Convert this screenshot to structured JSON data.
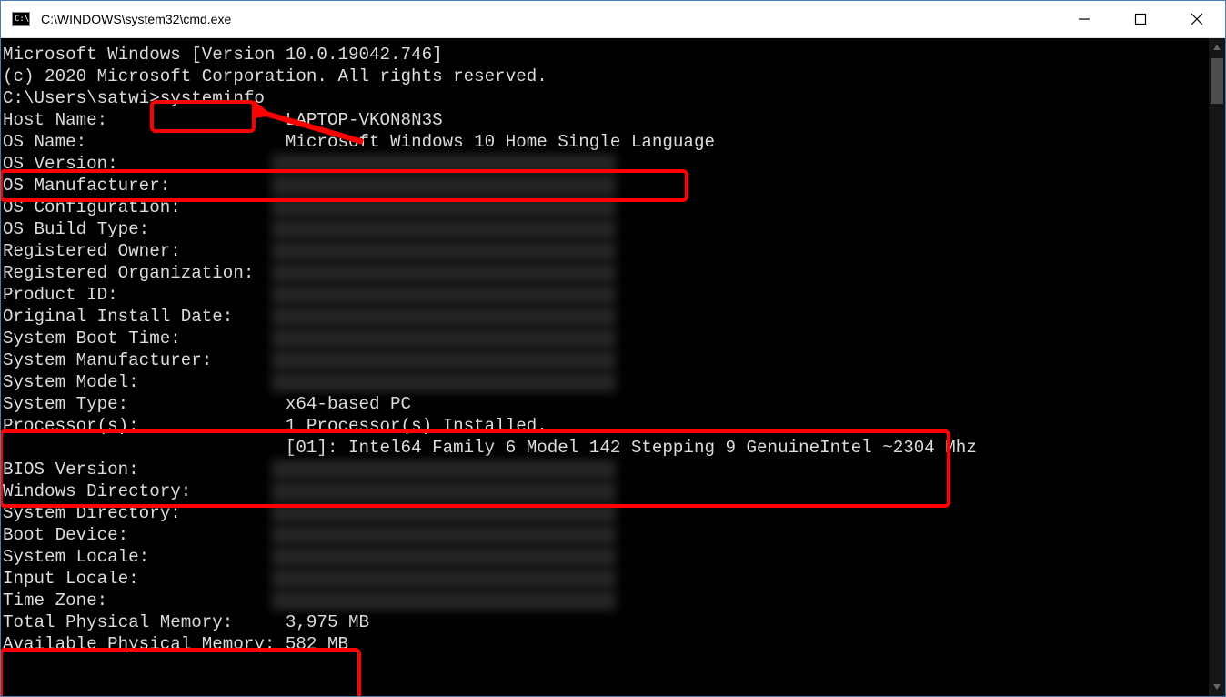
{
  "window": {
    "title": "C:\\WINDOWS\\system32\\cmd.exe",
    "icon_label": "C:\\."
  },
  "header": {
    "line1": "Microsoft Windows [Version 10.0.19042.746]",
    "line2": "(c) 2020 Microsoft Corporation. All rights reserved."
  },
  "prompt": {
    "path": "C:\\Users\\satwi>",
    "command": "systeminfo"
  },
  "rows": [
    {
      "label": "Host Name:",
      "value": "LAPTOP-VKON8N3S",
      "redacted": false
    },
    {
      "label": "OS Name:",
      "value": "Microsoft Windows 10 Home Single Language",
      "redacted": false
    },
    {
      "label": "OS Version:",
      "value": "",
      "redacted": true
    },
    {
      "label": "OS Manufacturer:",
      "value": "",
      "redacted": true
    },
    {
      "label": "OS Configuration:",
      "value": "",
      "redacted": true
    },
    {
      "label": "OS Build Type:",
      "value": "",
      "redacted": true
    },
    {
      "label": "Registered Owner:",
      "value": "",
      "redacted": true
    },
    {
      "label": "Registered Organization:",
      "value": "",
      "redacted": true
    },
    {
      "label": "Product ID:",
      "value": "",
      "redacted": true
    },
    {
      "label": "Original Install Date:",
      "value": "",
      "redacted": true
    },
    {
      "label": "System Boot Time:",
      "value": "",
      "redacted": true
    },
    {
      "label": "System Manufacturer:",
      "value": "",
      "redacted": true
    },
    {
      "label": "System Model:",
      "value": "",
      "redacted": true
    },
    {
      "label": "System Type:",
      "value": "x64-based PC",
      "redacted": false
    },
    {
      "label": "Processor(s):",
      "value": "1 Processor(s) Installed.",
      "redacted": false
    },
    {
      "label": "",
      "value": "[01]: Intel64 Family 6 Model 142 Stepping 9 GenuineIntel ~2304 Mhz",
      "redacted": false
    },
    {
      "label": "BIOS Version:",
      "value": "",
      "redacted": true
    },
    {
      "label": "Windows Directory:",
      "value": "",
      "redacted": true
    },
    {
      "label": "System Directory:",
      "value": "",
      "redacted": true
    },
    {
      "label": "Boot Device:",
      "value": "",
      "redacted": true
    },
    {
      "label": "System Locale:",
      "value": "",
      "redacted": true
    },
    {
      "label": "Input Locale:",
      "value": "",
      "redacted": true
    },
    {
      "label": "Time Zone:",
      "value": "",
      "redacted": true
    },
    {
      "label": "Total Physical Memory:",
      "value": "3,975 MB",
      "redacted": false
    },
    {
      "label": "Available Physical Memory:",
      "value": "582 MB",
      "redacted": false
    }
  ]
}
